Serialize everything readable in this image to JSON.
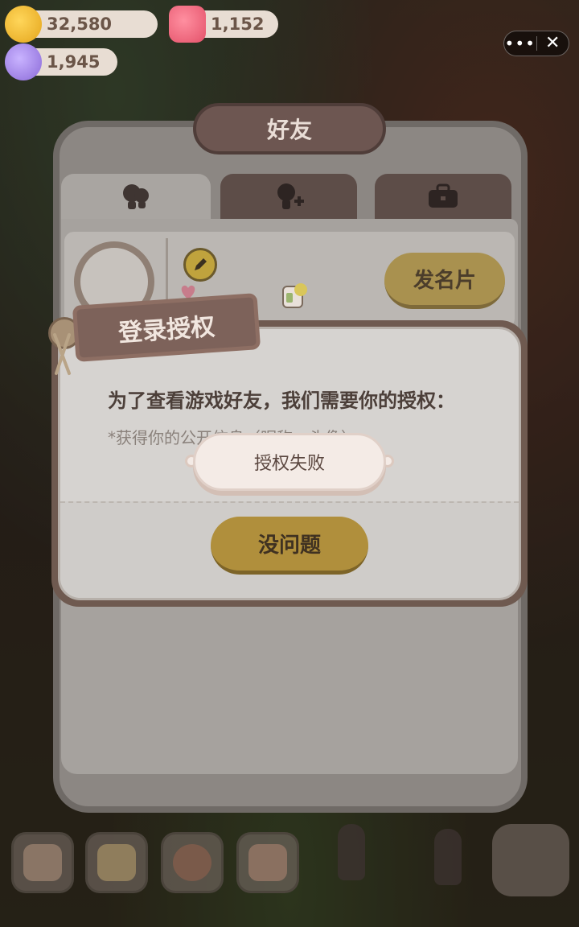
{
  "currencies": {
    "gold": "32,580",
    "pink": "1,152",
    "gem": "1,945"
  },
  "capsule": {
    "more": "•••",
    "close": "✕"
  },
  "friends_panel": {
    "title": "好友",
    "tabs": [
      {
        "icon": "friends-icon"
      },
      {
        "icon": "add-friend-icon"
      },
      {
        "icon": "briefcase-icon"
      }
    ],
    "send_card_label": "发名片"
  },
  "auth_dialog": {
    "title": "登录授权",
    "line1": "为了查看游戏好友，我们需要你的授权：",
    "line2": "*获得你的公开信息（昵称、头像）",
    "ok_label": "没问题"
  },
  "toast": {
    "message": "授权失败"
  },
  "colors": {
    "accent_gold": "#b08f3c",
    "dialog_frame": "#6f5a50",
    "toast_bg": "#f4ebe6"
  }
}
